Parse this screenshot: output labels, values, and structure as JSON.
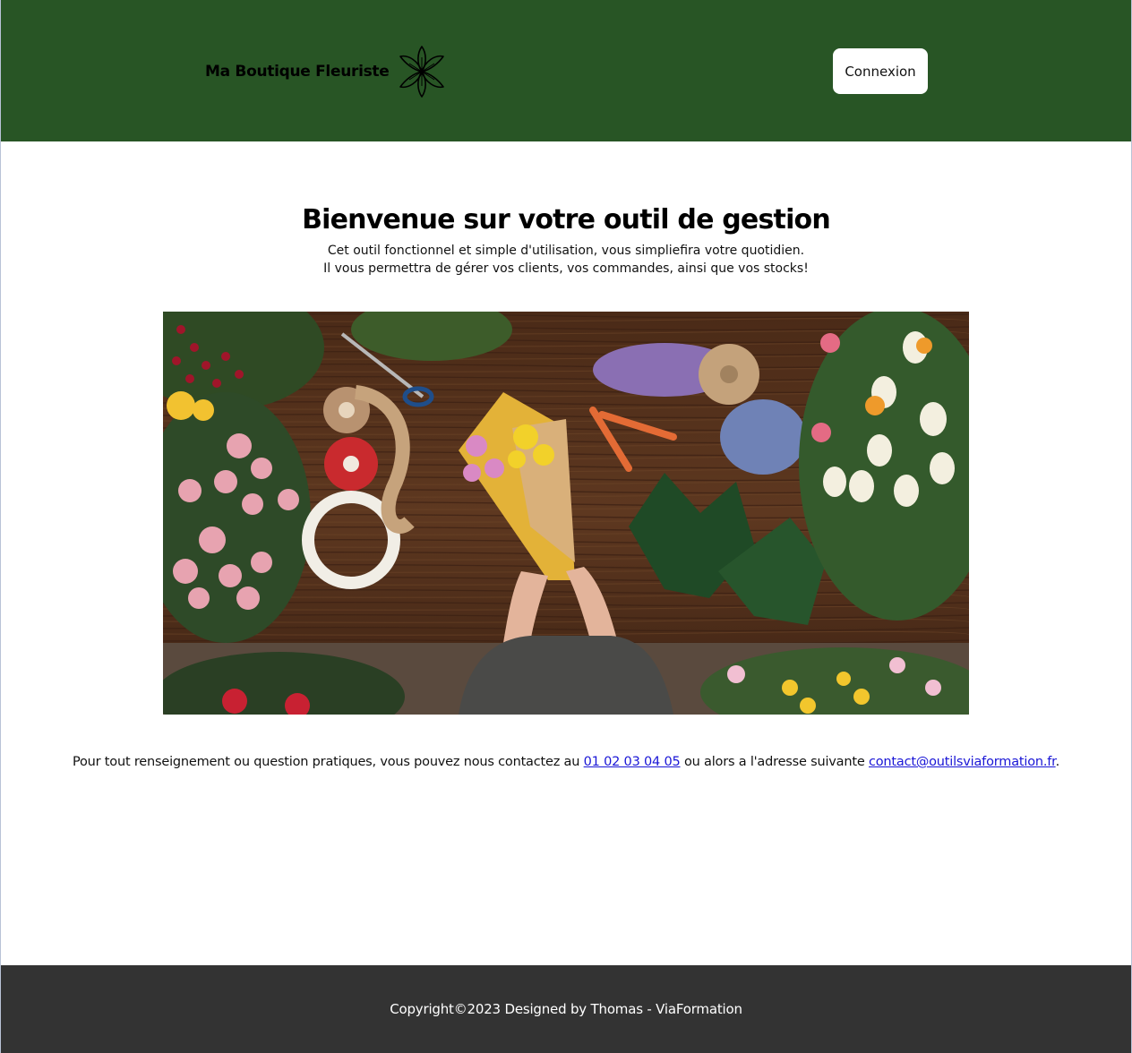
{
  "header": {
    "brand_name": "Ma Boutique Fleuriste",
    "logo_icon": "flower-outline-icon",
    "login_label": "Connexion",
    "background_color": "#285525"
  },
  "main": {
    "title": "Bienvenue sur votre outil de gestion",
    "intro_line_1": "Cet outil fonctionnel et simple d'utilisation, vous simpliefira votre quotidien.",
    "intro_line_2": "Il vous permettra de gérer vos clients, vos commandes, ainsi que vos stocks!",
    "hero_image": "florist-workbench-flowers-photo",
    "contact": {
      "text_before_phone": "Pour tout renseignement ou question pratiques, vous pouvez nous contactez au ",
      "phone": "01 02 03 04 05",
      "text_between": " ou alors a l'adresse suivante ",
      "email": "contact@outilsviaformation.fr",
      "text_after": ".",
      "link_color": "#1a16d6"
    }
  },
  "footer": {
    "copyright": "Copyright©2023 Designed by Thomas - ViaFormation",
    "background_color": "#333333"
  }
}
